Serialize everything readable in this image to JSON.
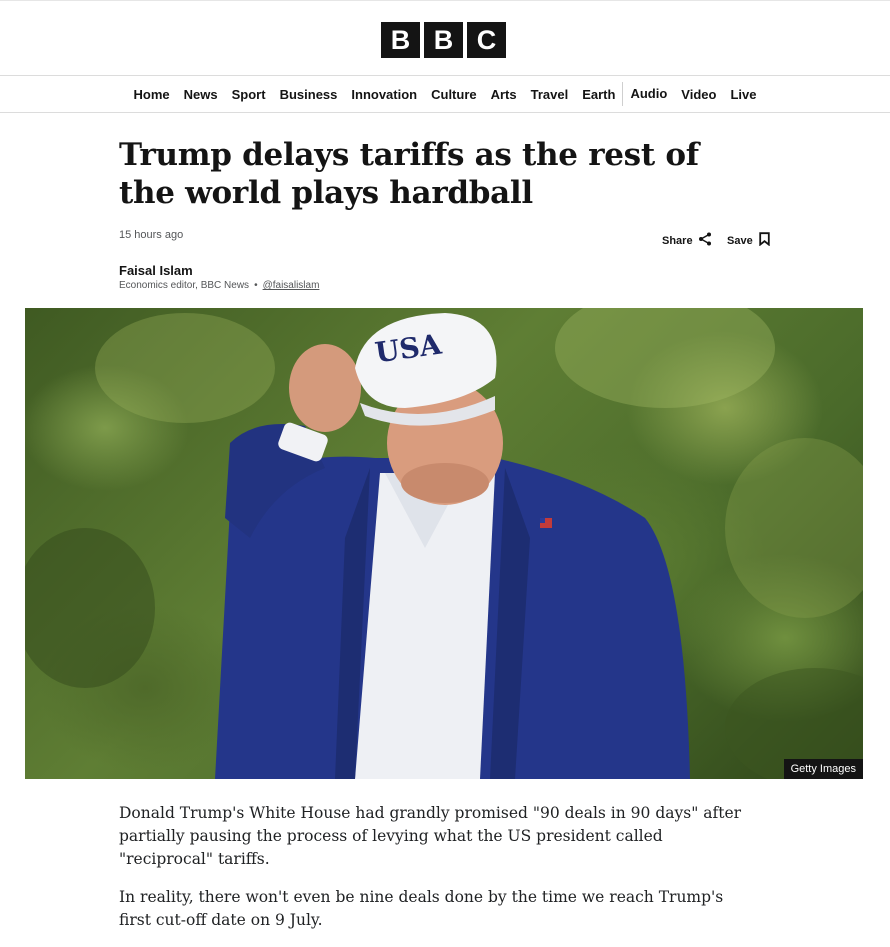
{
  "logo": {
    "letters": [
      "B",
      "B",
      "C"
    ]
  },
  "nav": {
    "items": [
      "Home",
      "News",
      "Sport",
      "Business",
      "Innovation",
      "Culture",
      "Arts",
      "Travel",
      "Earth",
      "Audio",
      "Video",
      "Live"
    ]
  },
  "article": {
    "headline": "Trump delays tariffs as the rest of the world plays hardball",
    "timestamp": "15 hours ago",
    "share_label": "Share",
    "save_label": "Save",
    "author": {
      "name": "Faisal Islam",
      "role": "Economics editor, BBC News",
      "handle": "@faisalislam"
    },
    "image": {
      "cap_text": "USA",
      "credit": "Getty Images"
    },
    "paragraphs": [
      "Donald Trump's White House had grandly promised \"90 deals in 90 days\" after partially pausing the process of levying what the US president called \"reciprocal\" tariffs.",
      "In reality, there won't even be nine deals done by the time we reach Trump's first cut-off date on 9 July."
    ]
  },
  "colors": {
    "text": "#141414",
    "muted": "#545658",
    "logo_bg": "#141414",
    "suit": "#24368a"
  },
  "icons": {
    "share": "share-icon",
    "save": "bookmark-icon"
  }
}
